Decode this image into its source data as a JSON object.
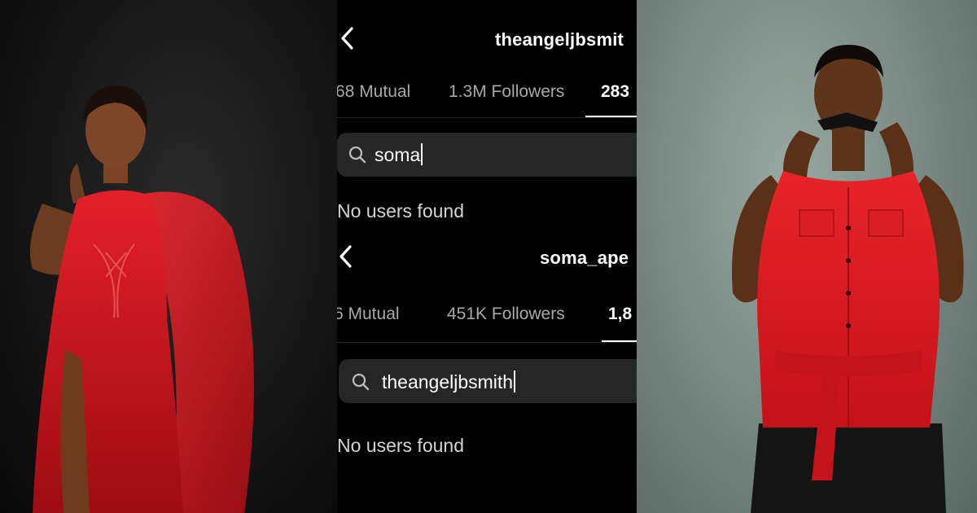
{
  "screens": [
    {
      "username": "theangeljbsmit",
      "tabs": [
        {
          "label": "68 Mutual",
          "active": false
        },
        {
          "label": "1.3M Followers",
          "active": false
        },
        {
          "label": "283",
          "active": true
        }
      ],
      "search": {
        "value": "soma"
      },
      "empty_state": "No users found"
    },
    {
      "username": "soma_ape",
      "tabs": [
        {
          "label": "6 Mutual",
          "active": false
        },
        {
          "label": "451K Followers",
          "active": false
        },
        {
          "label": "1,8",
          "active": true
        }
      ],
      "search": {
        "value": "theangeljbsmith"
      },
      "empty_state": "No users found"
    }
  ],
  "colors": {
    "background": "#000000",
    "search_field": "#262626",
    "inactive_tab": "#a8a8a8",
    "left_dress": "#d0121c",
    "right_vest": "#e01b1b",
    "right_backdrop": "#7d8c86"
  },
  "icons": [
    "back-chevron-icon",
    "search-icon"
  ]
}
